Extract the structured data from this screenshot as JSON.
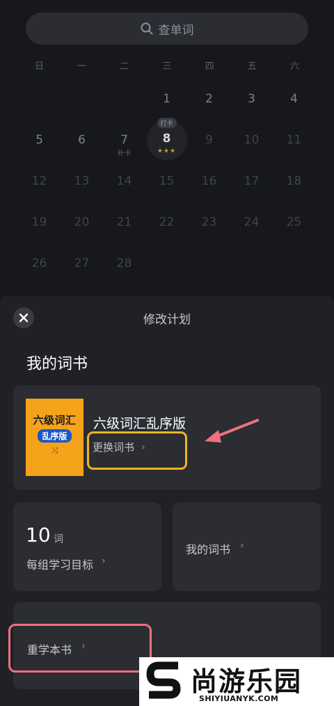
{
  "search": {
    "placeholder": "查单词",
    "icon": "search-icon"
  },
  "calendar": {
    "weekdays": [
      "日",
      "一",
      "二",
      "三",
      "四",
      "五",
      "六"
    ],
    "days": [
      {
        "n": "",
        "s": "blank"
      },
      {
        "n": "",
        "s": "blank"
      },
      {
        "n": "",
        "s": "blank"
      },
      {
        "n": "1",
        "s": "active"
      },
      {
        "n": "2",
        "s": "active"
      },
      {
        "n": "3",
        "s": "active"
      },
      {
        "n": "4",
        "s": "active"
      },
      {
        "n": "5",
        "s": "active"
      },
      {
        "n": "6",
        "s": "active"
      },
      {
        "n": "7",
        "s": "active",
        "note": "补卡"
      },
      {
        "n": "8",
        "s": "today",
        "badge": "打卡",
        "stars": "★★★"
      },
      {
        "n": "9",
        "s": "future"
      },
      {
        "n": "10",
        "s": "future"
      },
      {
        "n": "11",
        "s": "future"
      },
      {
        "n": "12",
        "s": "future"
      },
      {
        "n": "13",
        "s": "future"
      },
      {
        "n": "14",
        "s": "future"
      },
      {
        "n": "15",
        "s": "future"
      },
      {
        "n": "16",
        "s": "future"
      },
      {
        "n": "17",
        "s": "future"
      },
      {
        "n": "18",
        "s": "future"
      },
      {
        "n": "19",
        "s": "future"
      },
      {
        "n": "20",
        "s": "future"
      },
      {
        "n": "21",
        "s": "future"
      },
      {
        "n": "22",
        "s": "future"
      },
      {
        "n": "23",
        "s": "future"
      },
      {
        "n": "24",
        "s": "future"
      },
      {
        "n": "25",
        "s": "future"
      },
      {
        "n": "26",
        "s": "future"
      },
      {
        "n": "27",
        "s": "future"
      },
      {
        "n": "28",
        "s": "future"
      }
    ]
  },
  "sheet": {
    "title": "修改计划",
    "section_title": "我的词书",
    "book": {
      "name": "六级词汇乱序版",
      "cover_title": "六级词汇",
      "cover_sub": "乱序版",
      "change_label": "更换词书"
    },
    "goal": {
      "number": "10",
      "unit": "词",
      "label": "每组学习目标"
    },
    "my_books_label": "我的词书",
    "relearn_label": "重学本书"
  },
  "watermark": {
    "cn": "尚游乐园",
    "en": "SHIYIUANYK.COM"
  },
  "colors": {
    "accent_yellow": "#f1b422",
    "accent_pink": "#f0707f",
    "cover_orange": "#f5a31a",
    "sheet_bg": "#1f2126",
    "card_bg": "#2b2d33"
  }
}
